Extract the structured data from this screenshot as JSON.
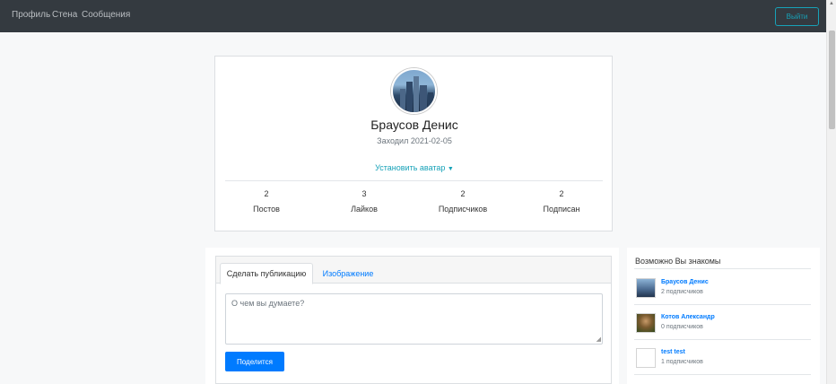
{
  "nav": {
    "links": [
      "Профиль",
      "Стена",
      "Сообщения"
    ],
    "logout_label": "Выйти"
  },
  "profile": {
    "name": "Браусов Денис",
    "last_seen": "Заходил 2021-02-05",
    "set_avatar_label": "Установить аватар",
    "stats": [
      {
        "value": "2",
        "label": "Постов"
      },
      {
        "value": "3",
        "label": "Лайков"
      },
      {
        "value": "2",
        "label": "Подписчиков"
      },
      {
        "value": "2",
        "label": "Подписан"
      }
    ]
  },
  "post_form": {
    "tabs": [
      "Сделать публикацию",
      "Изображение"
    ],
    "placeholder": "О чем вы думаете?",
    "share_label": "Поделится"
  },
  "suggestions": {
    "title": "Возможно Вы знакомы",
    "people": [
      {
        "name": "Браусов Денис",
        "subscribers": "2 подписчиков"
      },
      {
        "name": "Котов Александр",
        "subscribers": "0 подписчиков"
      },
      {
        "name": "test test",
        "subscribers": "1 подписчиков"
      }
    ]
  },
  "colors": {
    "navbar": "#343a40",
    "accent_teal": "#17a2b8",
    "primary_blue": "#007bff"
  }
}
